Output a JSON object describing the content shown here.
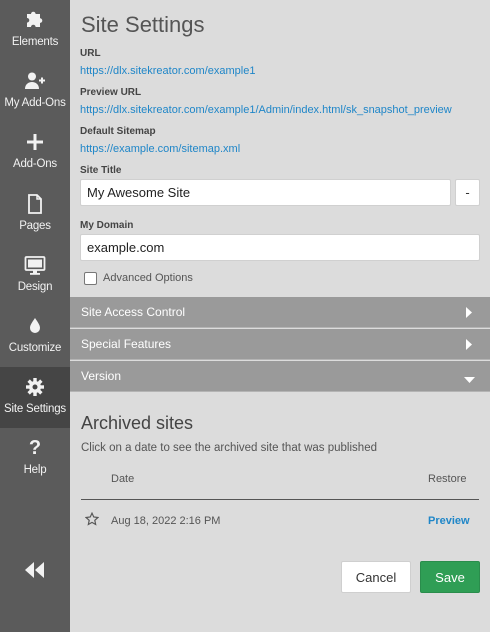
{
  "sidebar": {
    "items": [
      {
        "label": "Elements",
        "icon": "puzzle-icon"
      },
      {
        "label": "My Add-Ons",
        "icon": "user-plus-icon"
      },
      {
        "label": "Add-Ons",
        "icon": "plus-icon"
      },
      {
        "label": "Pages",
        "icon": "page-icon"
      },
      {
        "label": "Design",
        "icon": "monitor-icon"
      },
      {
        "label": "Customize",
        "icon": "droplet-icon"
      },
      {
        "label": "Site Settings",
        "icon": "gear-icon",
        "active": true
      },
      {
        "label": "Help",
        "icon": "question-icon"
      }
    ],
    "collapse_icon": "double-chevron-left-icon"
  },
  "main": {
    "title": "Site Settings",
    "url": {
      "label": "URL",
      "value": "https://dlx.sitekreator.com/example1"
    },
    "preview_url": {
      "label": "Preview URL",
      "value": "https://dlx.sitekreator.com/example1/Admin/index.html/sk_snapshot_preview"
    },
    "default_sitemap": {
      "label": "Default Sitemap",
      "value": "https://example.com/sitemap.xml"
    },
    "site_title": {
      "label": "Site Title",
      "value": "My Awesome Site",
      "button_label": "-"
    },
    "my_domain": {
      "label": "My Domain",
      "value": "example.com"
    },
    "advanced_options": {
      "label": "Advanced Options",
      "checked": false
    },
    "sections": [
      {
        "label": "Site Access Control",
        "state": "collapsed"
      },
      {
        "label": "Special Features",
        "state": "collapsed"
      },
      {
        "label": "Version",
        "state": "expanded"
      }
    ],
    "archived": {
      "title": "Archived sites",
      "subtitle": "Click on a date to see the archived site that was published",
      "columns": {
        "date": "Date",
        "restore": "Restore"
      },
      "rows": [
        {
          "date": "Aug 18, 2022 2:16 PM",
          "action": "Preview"
        }
      ]
    },
    "buttons": {
      "cancel": "Cancel",
      "save": "Save"
    }
  },
  "colors": {
    "sidebar_bg": "#5b5b5b",
    "sidebar_active": "#454545",
    "link": "#1f86c8",
    "accordion_bg": "#9a9a9a",
    "save_bg": "#2f9e55"
  }
}
